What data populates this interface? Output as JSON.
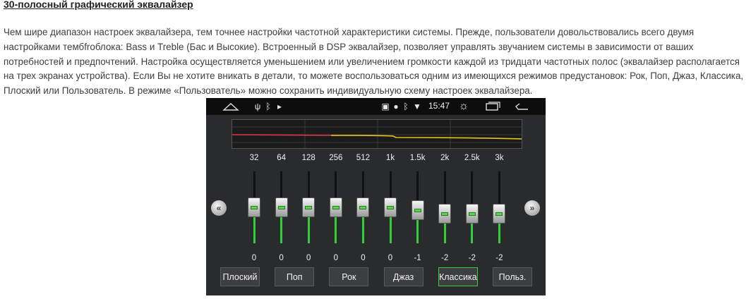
{
  "article": {
    "heading": "30-полосный графический эквалайзер",
    "paragraph": "Чем шире диапазон настроек эквалайзера, тем точнее настройки частотной характеристики системы. Прежде, пользователи довольствовались всего двумя настройками тембfroблока: Bass и Treble (Бас и Высокие). Встроенный в DSP эквалайзер, позволяет управлять звучанием системы в зависимости от ваших потребностей и предпочтений. Настройка осуществляется уменьшением или увеличением громкости каждой из тридцати частотных полос (эквалайзер располагается на трех экранах устройства). Если Вы не хотите вникать в детали, то можете воспользоваться одним из имеющихся режимов предустановок: Рок, Поп, Джаз, Классика, Плоский или Пользователь. В режиме «Пользователь» можно сохранить индивидуальную схему настроек эквалайзера."
  },
  "statusbar": {
    "time": "15:47",
    "icons_left": [
      "home-icon",
      "usb-icon",
      "bluetooth-icon",
      "play-icon"
    ],
    "icons_right": [
      "cast-icon",
      "location-icon",
      "bluetooth-icon",
      "wifi-icon",
      "brightness-icon",
      "recent-apps-icon",
      "back-icon"
    ]
  },
  "equalizer": {
    "bands": [
      {
        "freq": "32",
        "value": "0"
      },
      {
        "freq": "64",
        "value": "0"
      },
      {
        "freq": "128",
        "value": "0"
      },
      {
        "freq": "256",
        "value": "0"
      },
      {
        "freq": "512",
        "value": "0"
      },
      {
        "freq": "1k",
        "value": "0"
      },
      {
        "freq": "1.5k",
        "value": "-1"
      },
      {
        "freq": "2k",
        "value": "-2"
      },
      {
        "freq": "2.5k",
        "value": "-2"
      },
      {
        "freq": "3k",
        "value": "-2"
      }
    ],
    "range": [
      -12,
      12
    ],
    "curve_colors": {
      "bass": "#e0344a",
      "treble": "#e8c31a"
    },
    "accent": "#2fd03a"
  },
  "presets": [
    {
      "label": "Плоский",
      "active": false
    },
    {
      "label": "Поп",
      "active": false
    },
    {
      "label": "Рок",
      "active": false
    },
    {
      "label": "Джаз",
      "active": false
    },
    {
      "label": "Классика",
      "active": true
    },
    {
      "label": "Польз.",
      "active": false
    }
  ],
  "nav": {
    "prev": "prev-page-icon",
    "next": "next-page-icon"
  }
}
